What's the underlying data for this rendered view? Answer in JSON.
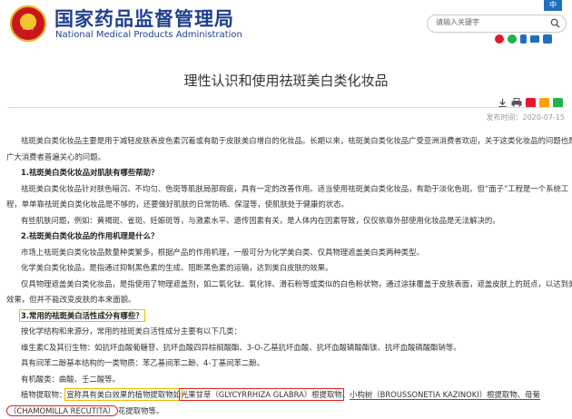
{
  "header": {
    "logo_cn": "国家药品监督管理局",
    "logo_en": "National Medical Products Administration",
    "lang_button": "中",
    "search_placeholder": "请输入关键字",
    "brand_color": "#1f3f8f"
  },
  "article": {
    "title": "理性认识和使用祛斑美白类化妆品",
    "publish_date": "发布时间：2020-07-15",
    "paragraphs": {
      "p1a": "祛斑美白类化妆品主要是用于减轻皮肤表皮色素沉着或有助于皮肤美白增白的化妆品。长期以来，祛斑美白类化妆品广受亚洲消费者欢迎，关于这类化妆品的问题也是",
      "p1b": "广大消费者普遍关心的问题。",
      "h1": "1.祛斑美白类化妆品对肌肤有哪些帮助？",
      "p2a": "祛斑美白类化妆品针对肤色暗沉、不均匀、色斑等肌肤局部瑕疵，具有一定的改善作用。适当使用祛斑美白类化妆品，有助于淡化色斑。但“面子”工程是一个系统工",
      "p2b": "程，单单靠祛斑美白类化妆品是不够的，还要做好肌肤的日常防晒、保湿等，使肌肤处于健康的状态。",
      "p3": "有些肌肤问题，例如：黄褐斑、雀斑、妊娠斑等，与激素水平、遗传因素有关，是人体内在因素导致，仅仅依靠外部使用化妆品是无法解决的。",
      "h2": "2.祛斑美白类化妆品的作用机理是什么？",
      "p4": "市场上祛斑美白类化妆品数量种类繁多，根据产品的作用机理，一般可分为化学美白类、仅具物理遮盖美白类两种类型。",
      "p5": "化学美白类化妆品，是指通过抑制黑色素的生成、阻断黑色素的运输，达到美白皮肤的效果。",
      "p6a": "仅具物理遮盖美白类化妆品，是指使用了物理遮盖剂，如二氧化钛、氧化锌、滑石粉等或类似的白色粉状物，通过涂抹覆盖于皮肤表面，遮盖皮肤上的斑点，以达到美白的",
      "p6b": "效果，但并不能改变皮肤的本来面貌。",
      "h3": "3.常用的祛斑美白活性成分有哪些？",
      "p7": "按化学结构和来源分，常用的祛斑美白活性成分主要有以下几类：",
      "p8": "维生素C及其衍生物：如抗坏血酸葡糖苷、抗坏血酸四异棕榈酸酯、3-O-乙基抗坏血酸、抗坏血酸磷酸酯镁、抗坏血酸磷酸酯钠等。",
      "p9": "具有间苯二酚基本结构的一类物质：苯乙基间苯二酚、4-丁基间苯二酚。",
      "p10": "有机酸类：曲酸、壬二酸等。",
      "p11_a": "植物提取物：",
      "p11_b": "宣称具有美白效果的植物提取物如",
      "p11_c": "光果甘草（GLYCYRRHIZA GLABRA）根提取物",
      "p11_d": "、",
      "p11_e": "小构树（BROUSSONETIA KAZINOKI）根提取物、母菊",
      "p12_a": "（CHAMOMILLA RECUTITA）",
      "p12_b": "花提取物等。"
    }
  }
}
